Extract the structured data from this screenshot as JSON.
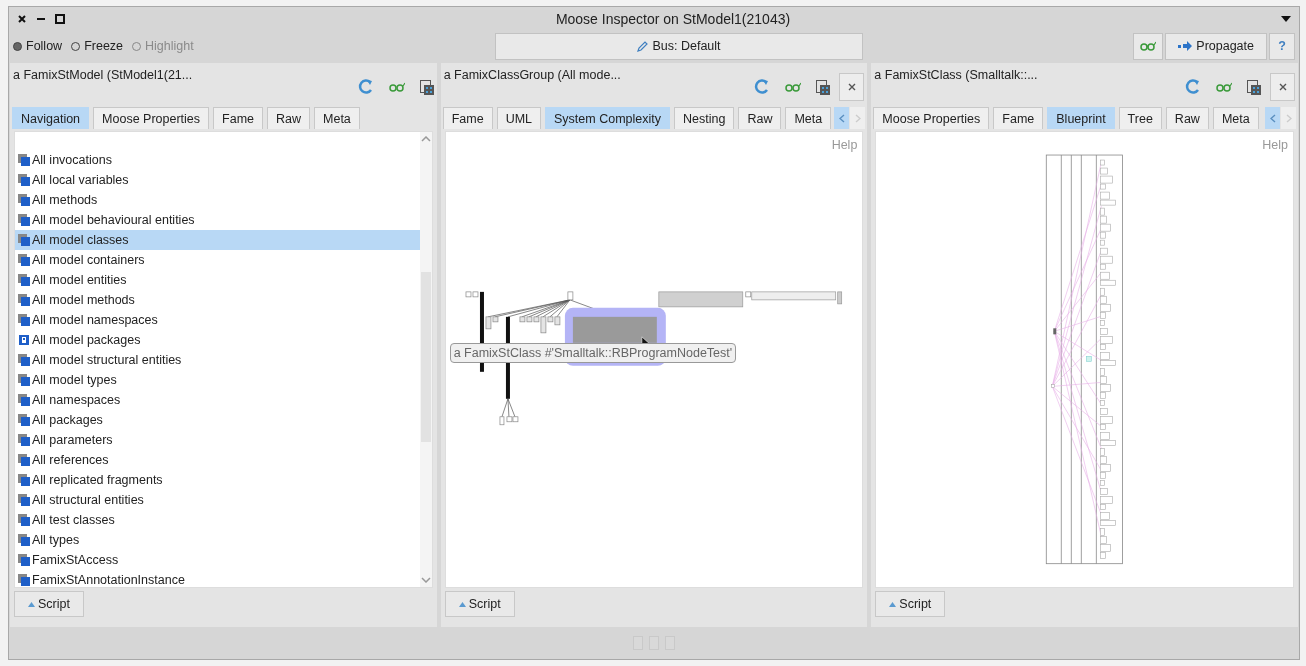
{
  "window": {
    "title": "Moose Inspector on StModel1(21043)"
  },
  "modes": [
    {
      "label": "Follow",
      "selected": true,
      "disabled": false
    },
    {
      "label": "Freeze",
      "selected": false,
      "disabled": false
    },
    {
      "label": "Highlight",
      "selected": false,
      "disabled": true
    }
  ],
  "bus_button": {
    "label": "Bus: Default"
  },
  "propagate_button": {
    "label": "Propagate"
  },
  "help_button": {
    "label": "?"
  },
  "panes": [
    {
      "title": "a FamixStModel (StModel1(21...",
      "closable": false,
      "scroll_arrows": false,
      "tabs": [
        {
          "label": "Navigation",
          "selected": true
        },
        {
          "label": "Moose Properties",
          "selected": false
        },
        {
          "label": "Fame",
          "selected": false
        },
        {
          "label": "Raw",
          "selected": false
        },
        {
          "label": "Meta",
          "selected": false
        }
      ],
      "content": {
        "kind": "list",
        "items": [
          {
            "label": "All invocations",
            "kind": "group",
            "selected": false
          },
          {
            "label": "All local variables",
            "kind": "group",
            "selected": false
          },
          {
            "label": "All methods",
            "kind": "group",
            "selected": false
          },
          {
            "label": "All model behavioural entities",
            "kind": "group",
            "selected": false
          },
          {
            "label": "All model classes",
            "kind": "group",
            "selected": true
          },
          {
            "label": "All model containers",
            "kind": "group",
            "selected": false
          },
          {
            "label": "All model entities",
            "kind": "group",
            "selected": false
          },
          {
            "label": "All model methods",
            "kind": "group",
            "selected": false
          },
          {
            "label": "All model namespaces",
            "kind": "group",
            "selected": false
          },
          {
            "label": "All model packages",
            "kind": "package",
            "selected": false
          },
          {
            "label": "All model structural entities",
            "kind": "group",
            "selected": false
          },
          {
            "label": "All model types",
            "kind": "group",
            "selected": false
          },
          {
            "label": "All namespaces",
            "kind": "group",
            "selected": false
          },
          {
            "label": "All packages",
            "kind": "group",
            "selected": false
          },
          {
            "label": "All parameters",
            "kind": "group",
            "selected": false
          },
          {
            "label": "All references",
            "kind": "group",
            "selected": false
          },
          {
            "label": "All replicated fragments",
            "kind": "group",
            "selected": false
          },
          {
            "label": "All structural entities",
            "kind": "group",
            "selected": false
          },
          {
            "label": "All test classes",
            "kind": "group",
            "selected": false
          },
          {
            "label": "All types",
            "kind": "group",
            "selected": false
          },
          {
            "label": "FamixStAccess",
            "kind": "group",
            "selected": false
          },
          {
            "label": "FamixStAnnotationInstance",
            "kind": "group",
            "selected": false
          }
        ]
      },
      "script_button": "Script"
    },
    {
      "title": "a FamixClassGroup (All mode...",
      "closable": true,
      "scroll_arrows": true,
      "tabs": [
        {
          "label": "Fame",
          "selected": false
        },
        {
          "label": "UML",
          "selected": false
        },
        {
          "label": "System Complexity",
          "selected": true
        },
        {
          "label": "Nesting",
          "selected": false
        },
        {
          "label": "Raw",
          "selected": false
        },
        {
          "label": "Meta",
          "selected": false
        }
      ],
      "content": {
        "kind": "complexity",
        "help": "Help",
        "tooltip": "a FamixStClass #'Smalltalk::RBProgramNodeTest'"
      },
      "script_button": "Script"
    },
    {
      "title": "a FamixStClass (Smalltalk::...",
      "closable": true,
      "scroll_arrows": true,
      "tabs": [
        {
          "label": "Moose Properties",
          "selected": false
        },
        {
          "label": "Fame",
          "selected": false
        },
        {
          "label": "Blueprint",
          "selected": true
        },
        {
          "label": "Tree",
          "selected": false
        },
        {
          "label": "Raw",
          "selected": false
        },
        {
          "label": "Meta",
          "selected": false
        }
      ],
      "content": {
        "kind": "blueprint",
        "help": "Help"
      },
      "script_button": "Script"
    }
  ]
}
